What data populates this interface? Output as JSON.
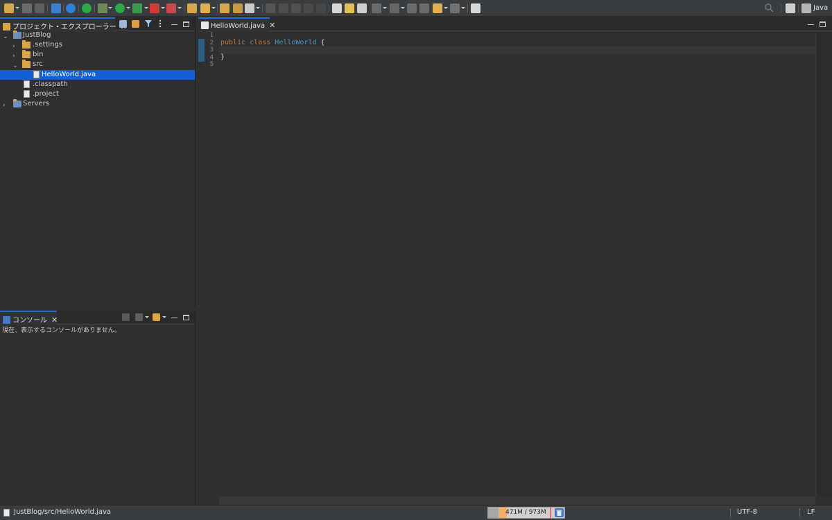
{
  "toolbar": {
    "perspective_label": "Java"
  },
  "explorer": {
    "tab_label": "プロジェクト・エクスプローラー",
    "items": [
      {
        "label": "JustBlog"
      },
      {
        "label": ".settings"
      },
      {
        "label": "bin"
      },
      {
        "label": "src"
      },
      {
        "label": "HelloWorld.java"
      },
      {
        "label": ".classpath"
      },
      {
        "label": ".project"
      },
      {
        "label": "Servers"
      }
    ]
  },
  "console": {
    "tab_label": "コンソール",
    "message": "現在、表示するコンソールがありません。"
  },
  "editor": {
    "tab_label": "HelloWorld.java",
    "line_numbers": [
      "1",
      "2",
      "3",
      "4",
      "5"
    ],
    "code": {
      "kw1": "public",
      "kw2": "class",
      "class_name": "HelloWorld",
      "open_brace": "{",
      "close_brace": "}"
    }
  },
  "statusbar": {
    "path": "JustBlog/src/HelloWorld.java",
    "heap": "471M / 973M",
    "encoding": "UTF-8",
    "line_delimiter": "LF"
  },
  "colors": {
    "selection": "#1460d2",
    "keyword": "#cc7832",
    "class_name": "#3aa0d8",
    "tab_accent": "#1e6fd9"
  }
}
